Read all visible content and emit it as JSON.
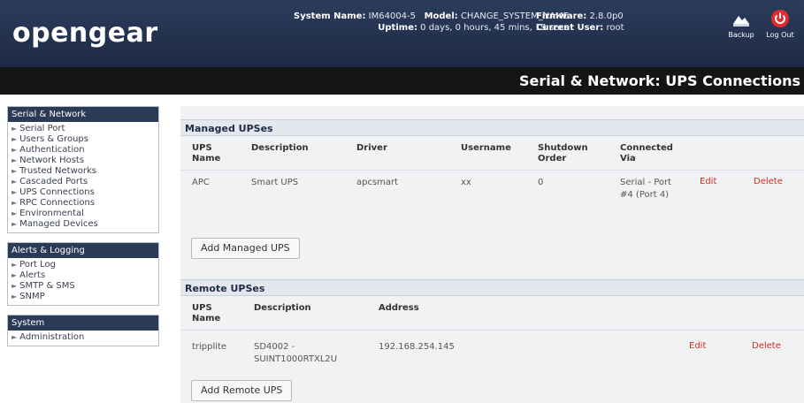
{
  "header": {
    "logo": "opengear",
    "system_name_label": "System Name:",
    "system_name_value": "IM64004-5",
    "model_label": "Model:",
    "model_value": "CHANGE_SYSTEM_NAME",
    "uptime_label": "Uptime:",
    "uptime_value": "0 days, 0 hours, 45 mins, 19 secs",
    "firmware_label": "Firmware:",
    "firmware_value": "2.8.0p0",
    "current_user_label": "Current User:",
    "current_user_value": "root",
    "backup_label": "Backup",
    "logout_label": "Log Out"
  },
  "page_title": "Serial & Network: UPS Connections",
  "sidebar": {
    "sections": [
      {
        "title": "Serial & Network",
        "items": [
          "Serial Port",
          "Users & Groups",
          "Authentication",
          "Network Hosts",
          "Trusted Networks",
          "Cascaded Ports",
          "UPS Connections",
          "RPC Connections",
          "Environmental",
          "Managed Devices"
        ]
      },
      {
        "title": "Alerts & Logging",
        "items": [
          "Port Log",
          "Alerts",
          "SMTP & SMS",
          "SNMP"
        ]
      },
      {
        "title": "System",
        "items": [
          "Administration"
        ]
      }
    ]
  },
  "managed": {
    "title": "Managed UPSes",
    "headers": {
      "name": "UPS Name",
      "description": "Description",
      "driver": "Driver",
      "username": "Username",
      "shutdown": "Shutdown Order",
      "connected": "Connected Via"
    },
    "rows": [
      {
        "name": "APC",
        "description": "Smart UPS",
        "driver": "apcsmart",
        "username": "xx",
        "shutdown": "0",
        "connected": "Serial - Port #4 (Port 4)",
        "edit": "Edit",
        "delete": "Delete"
      }
    ],
    "add_button": "Add Managed UPS"
  },
  "remote": {
    "title": "Remote UPSes",
    "headers": {
      "name": "UPS Name",
      "description": "Description",
      "address": "Address"
    },
    "rows": [
      {
        "name": "tripplite",
        "description": "SD4002 - SUINT1000RTXL2U",
        "address": "192.168.254.145",
        "edit": "Edit",
        "delete": "Delete"
      }
    ],
    "add_button": "Add Remote UPS"
  },
  "colors": {
    "header_bg": "#1d2a44",
    "titlebar_bg": "#151515",
    "link_red": "#d62a1e",
    "section_header_bg": "#e4e7ee"
  }
}
